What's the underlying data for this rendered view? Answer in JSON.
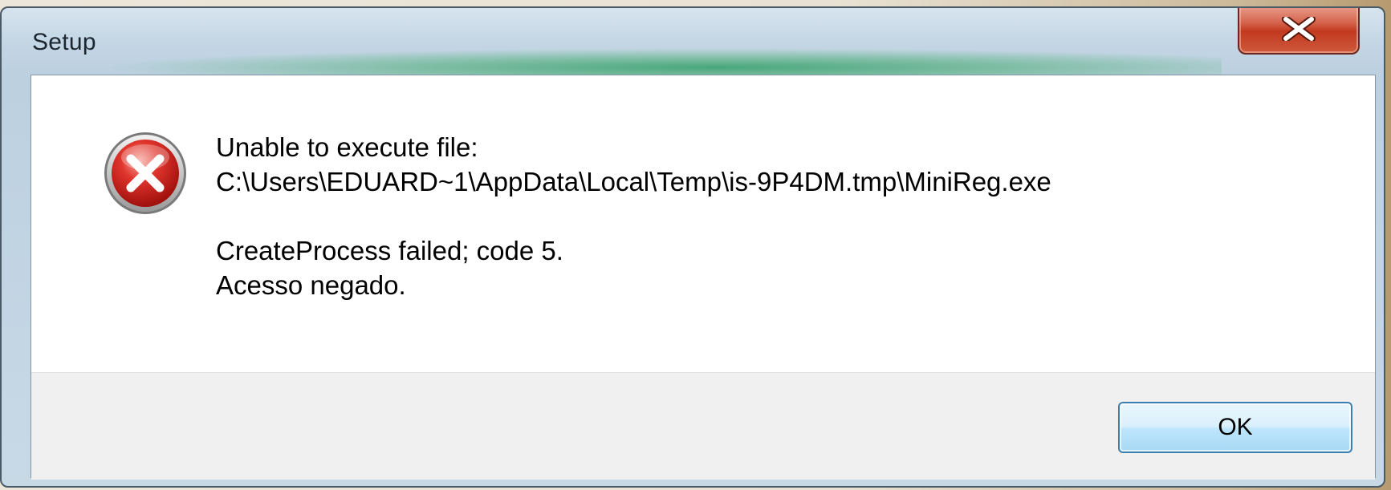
{
  "window": {
    "title": "Setup",
    "close_icon": "close-x-icon"
  },
  "message": {
    "icon": "error-icon",
    "line1": "Unable to execute file:",
    "line2": "C:\\Users\\EDUARD~1\\AppData\\Local\\Temp\\is-9P4DM.tmp\\MiniReg.exe",
    "line3": "CreateProcess failed; code 5.",
    "line4": "Acesso negado."
  },
  "buttons": {
    "ok_label": "OK"
  },
  "colors": {
    "close_button": "#c2391f",
    "error_icon": "#cc1f1a",
    "ok_border": "#3c7fb1"
  }
}
